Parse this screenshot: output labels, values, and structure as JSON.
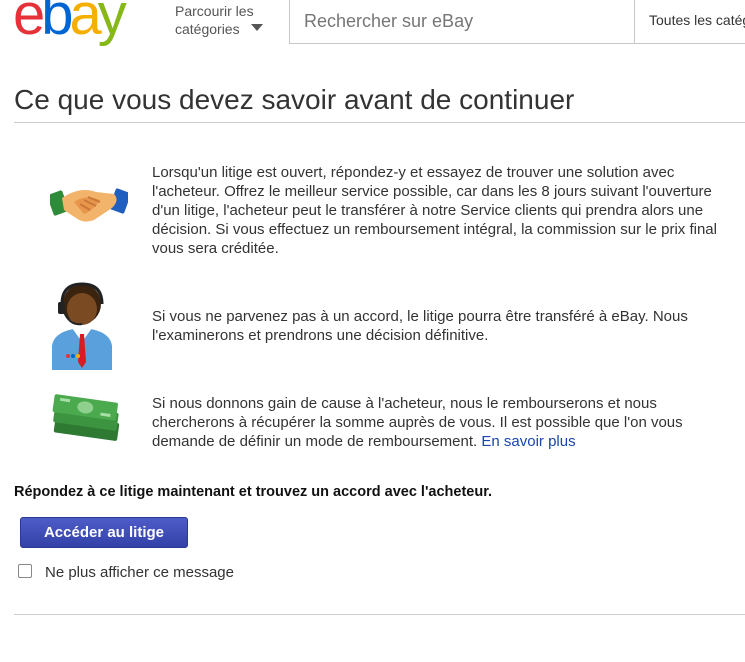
{
  "header": {
    "logo_letters": [
      "e",
      "b",
      "a",
      "y"
    ],
    "browse_line1": "Parcourir les",
    "browse_line2": "catégories",
    "search_placeholder": "Rechercher sur eBay",
    "category_select": "Toutes les catégories"
  },
  "page_title": "Ce que vous devez savoir avant de continuer",
  "info_blocks": [
    {
      "icon": "handshake-icon",
      "text": "Lorsqu'un litige est ouvert, répondez-y et essayez de trouver une solution avec l'acheteur. Offrez le meilleur service possible, car dans les 8 jours suivant l'ouverture d'un litige, l'acheteur peut le transférer à notre Service clients qui prendra alors une décision. Si vous effectuez un remboursement intégral, la commission sur le prix final vous sera créditée."
    },
    {
      "icon": "support-agent-icon",
      "text": "Si vous ne parvenez pas à un accord, le litige pourra être transféré à eBay. Nous l'examinerons et prendrons une décision définitive."
    },
    {
      "icon": "money-stack-icon",
      "text": "Si nous donnons gain de cause à l'acheteur, nous le rembourserons et nous chercherons à récupérer la somme auprès de vous. Il est possible que l'on vous demande de définir un mode de remboursement.",
      "link": "En savoir plus"
    }
  ],
  "prompt": "Répondez à ce litige maintenant et trouvez un accord avec l'acheteur.",
  "button_label": "Accéder au litige",
  "checkbox_label": "Ne plus afficher ce message",
  "colors": {
    "logo_e": "#e53238",
    "logo_b": "#0064d2",
    "logo_a": "#f5af02",
    "logo_y": "#86b817",
    "button": "#3d4cb5",
    "link": "#1a46a9"
  }
}
